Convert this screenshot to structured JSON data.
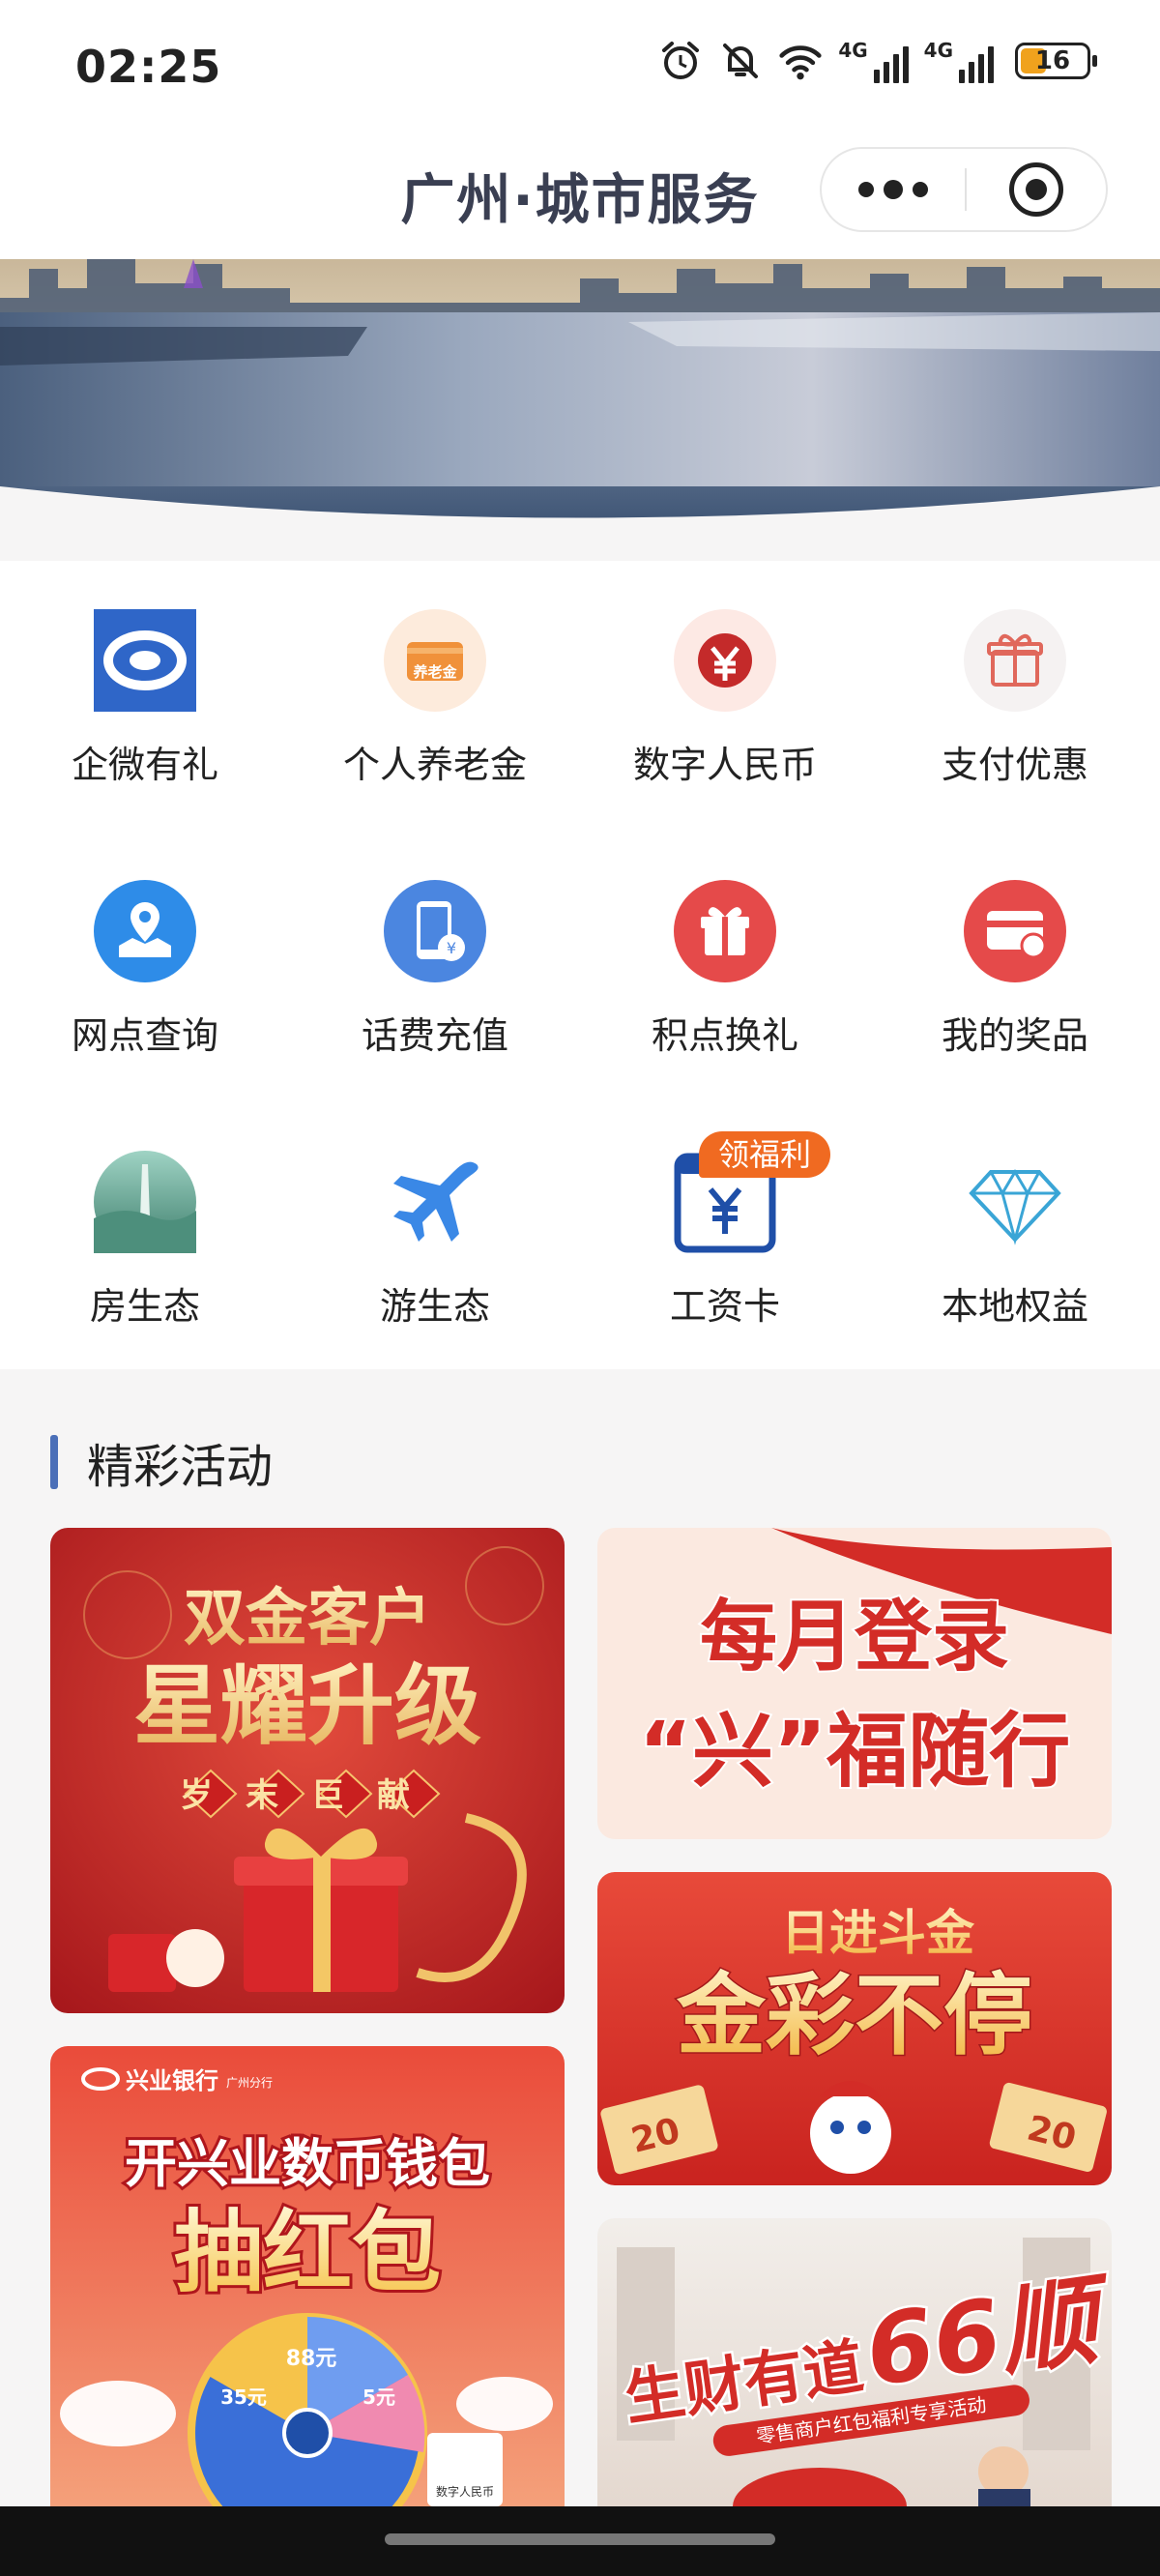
{
  "status_bar": {
    "time": "02:25",
    "network1": "4G",
    "network2": "4G",
    "battery": "16"
  },
  "nav": {
    "title": "广州·城市服务"
  },
  "grid": [
    {
      "label": "企微有礼",
      "icon": "wechat-work-icon"
    },
    {
      "label": "个人养老金",
      "icon": "pension-card-icon",
      "icon_text": "养老金"
    },
    {
      "label": "数字人民币",
      "icon": "digital-rmb-icon"
    },
    {
      "label": "支付优惠",
      "icon": "gift-icon"
    },
    {
      "label": "网点查询",
      "icon": "map-pin-icon"
    },
    {
      "label": "话费充值",
      "icon": "phone-topup-icon"
    },
    {
      "label": "积点换礼",
      "icon": "red-gift-icon"
    },
    {
      "label": "我的奖品",
      "icon": "prize-card-icon"
    },
    {
      "label": "房生态",
      "icon": "city-tower-icon"
    },
    {
      "label": "游生态",
      "icon": "airplane-icon"
    },
    {
      "label": "工资卡",
      "icon": "salary-card-icon"
    },
    {
      "label": "本地权益",
      "icon": "diamond-icon"
    }
  ],
  "salary_badge": "领福利",
  "section": {
    "title": "精彩活动"
  },
  "activities": {
    "a1": {
      "line1": "双金客户",
      "line2": "星耀升级",
      "line3": "岁末巨献"
    },
    "a2": {
      "line1": "每月登录",
      "line2": "“兴”福随行"
    },
    "a3": {
      "line1": "日进斗金",
      "line2": "金彩不停",
      "chip1": "20",
      "chip2": "20"
    },
    "a4": {
      "bank": "兴业银行",
      "bank_sub": "广州分行",
      "line1": "开兴业数币钱包",
      "line2": "抽红包",
      "wheel1": "88元",
      "wheel2": "35元",
      "wheel3": "5元",
      "tag": "数字人民币"
    },
    "a5": {
      "line1": "生财有道",
      "line2": "66顺",
      "sub": "零售商户红包福利专享活动"
    }
  },
  "colors": {
    "accent": "#4b6fb8",
    "badge": "#f06a21",
    "promo_red": "#d8312c",
    "gold": "#f5d27a"
  }
}
